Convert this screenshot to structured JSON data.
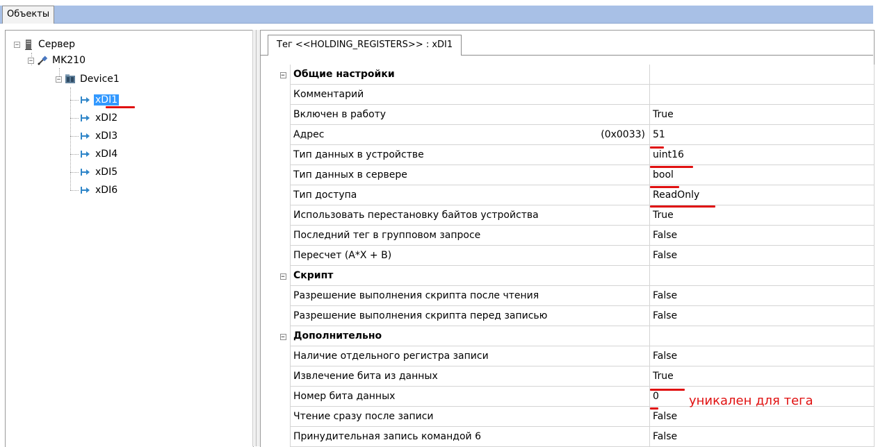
{
  "top_tab": {
    "label": "Объекты"
  },
  "tree": {
    "root": "Сервер",
    "module": "MK210",
    "device": "Device1",
    "tags": [
      "xDI1",
      "xDI2",
      "xDI3",
      "xDI4",
      "xDI5",
      "xDI6"
    ],
    "selected": "xDI1"
  },
  "properties_tab": {
    "label": "Тег  <<HOLDING_REGISTERS>> : xDI1"
  },
  "properties": {
    "general": {
      "title": "Общие настройки",
      "rows": [
        {
          "name": "Комментарий",
          "value": ""
        },
        {
          "name": "Включен в работу",
          "value": "True"
        },
        {
          "name": "Адрес",
          "hex": "(0x0033)",
          "value": "51"
        },
        {
          "name": "Тип данных в устройстве",
          "value": "uint16"
        },
        {
          "name": "Тип данных в сервере",
          "value": "bool"
        },
        {
          "name": "Тип доступа",
          "value": "ReadOnly"
        },
        {
          "name": "Использовать перестановку байтов устройства",
          "value": "True"
        },
        {
          "name": "Последний тег в групповом запросе",
          "value": "False"
        },
        {
          "name": "Пересчет (A*X + B)",
          "value": "False"
        }
      ]
    },
    "script": {
      "title": "Скрипт",
      "rows": [
        {
          "name": "Разрешение выполнения скрипта после чтения",
          "value": "False"
        },
        {
          "name": "Разрешение выполнения скрипта перед записью",
          "value": "False"
        }
      ]
    },
    "extra": {
      "title": "Дополнительно",
      "rows": [
        {
          "name": "Наличие отдельного регистра записи",
          "value": "False"
        },
        {
          "name": "Извлечение бита из данных",
          "value": "True"
        },
        {
          "name": "Номер бита данных",
          "value": "0"
        },
        {
          "name": "Чтение сразу после записи",
          "value": "False"
        },
        {
          "name": "Принудительная запись командой 6",
          "value": "False"
        }
      ]
    }
  },
  "annotation": {
    "text": "уникален для тега",
    "color": "#e01010"
  },
  "colors": {
    "tab_bar": "#a8c0e6",
    "selection": "#3399ff",
    "annotation_underline": "#e01010"
  }
}
